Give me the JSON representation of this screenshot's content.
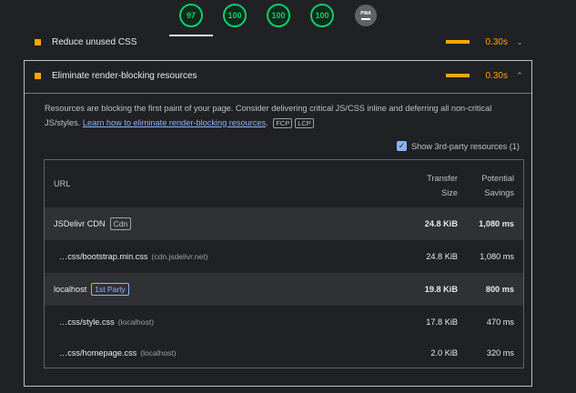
{
  "scores": [
    {
      "name": "performance",
      "value": "97"
    },
    {
      "name": "accessibility",
      "value": "100"
    },
    {
      "name": "best-practices",
      "value": "100"
    },
    {
      "name": "seo",
      "value": "100"
    }
  ],
  "pwa": {
    "label": "PWA"
  },
  "audits": {
    "collapsed": {
      "title": "Reduce unused CSS",
      "value": "0.30s",
      "chevron": "⌄"
    },
    "expanded": {
      "title": "Eliminate render-blocking resources",
      "value": "0.30s",
      "chevron": "⌃"
    }
  },
  "description": {
    "text": "Resources are blocking the first paint of your page. Consider delivering critical JS/CSS inline and deferring all non-critical JS/styles. ",
    "link": "Learn how to eliminate render-blocking resources",
    "after_link": ".",
    "tags": [
      "FCP",
      "LCP"
    ]
  },
  "third_party": {
    "label": "Show 3rd-party resources (1)",
    "checked": true
  },
  "table": {
    "headers": {
      "url": "URL",
      "size_line1": "Transfer",
      "size_line2": "Size",
      "savings_line1": "Potential",
      "savings_line2": "Savings"
    },
    "groups": [
      {
        "entity": "JSDelivr CDN",
        "badge": "Cdn",
        "size": "24.8 KiB",
        "savings": "1,080 ms",
        "items": [
          {
            "path": "…css/bootstrap.min.css",
            "host": "(cdn.jsdelivr.net)",
            "size": "24.8 KiB",
            "savings": "1,080 ms"
          }
        ]
      },
      {
        "entity": "localhost",
        "badge": "1st Party",
        "size": "19.8 KiB",
        "savings": "800 ms",
        "items": [
          {
            "path": "…css/style.css",
            "host": "(localhost)",
            "size": "17.8 KiB",
            "savings": "470 ms"
          },
          {
            "path": "…css/homepage.css",
            "host": "(localhost)",
            "size": "2.0 KiB",
            "savings": "320 ms"
          }
        ]
      }
    ]
  }
}
